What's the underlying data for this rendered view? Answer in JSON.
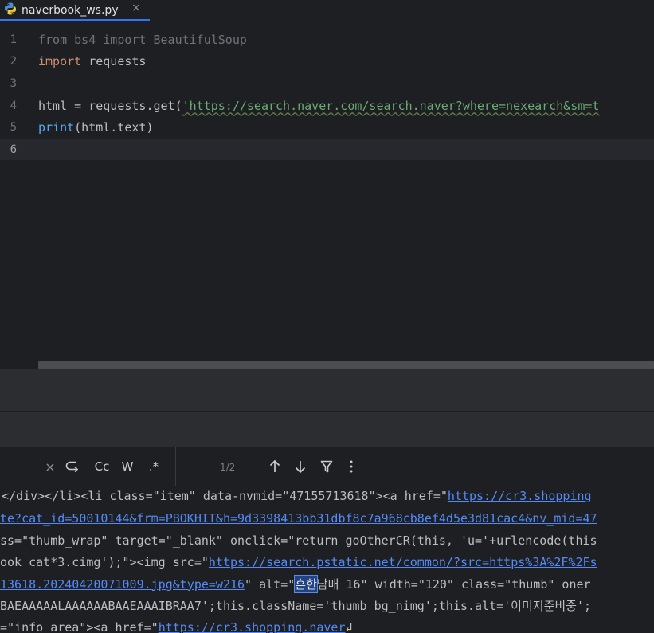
{
  "tab": {
    "filename": "naverbook_ws.py",
    "close_glyph": "×",
    "icon": "python-icon"
  },
  "editor": {
    "lines": [
      {
        "num": "1",
        "tokens": [
          {
            "t": "from bs4 import BeautifulSoup",
            "c": "dim"
          }
        ]
      },
      {
        "num": "2",
        "tokens": [
          {
            "t": "import",
            "c": "kw"
          },
          {
            "t": " requests",
            "c": ""
          }
        ]
      },
      {
        "num": "3",
        "tokens": []
      },
      {
        "num": "4",
        "tokens": [
          {
            "t": "html = requests.get(",
            "c": ""
          },
          {
            "t": "'https://search.naver.com/search.naver?where=nexearch&sm=t",
            "c": "str"
          }
        ]
      },
      {
        "num": "5",
        "tokens": [
          {
            "t": "print",
            "c": "fn"
          },
          {
            "t": "(html.text)",
            "c": ""
          }
        ]
      },
      {
        "num": "6",
        "tokens": []
      }
    ]
  },
  "find": {
    "close_glyph": "×",
    "regex_label": ".*",
    "match_case_label": "Cc",
    "words_label": "W",
    "count": "1/2",
    "icons": [
      "close-icon",
      "replace-icon",
      "match-case-icon",
      "words-icon",
      "regex-icon",
      "prev-icon",
      "next-icon",
      "filter-icon",
      "more-icon"
    ]
  },
  "output": {
    "lines": [
      [
        {
          "t": "</div></li><li class=\"item\" data-nvmid=\"47155713618\"><a href=\"",
          "c": ""
        },
        {
          "t": "https://cr3.shopping",
          "c": "link"
        }
      ],
      [
        {
          "t": "te?cat_id=50010144&frm=PBOKHIT&h=9d3398413bb31dbf8c7a968cb8ef4d5e3d81cac4&nv_mid=47",
          "c": "link"
        }
      ],
      [
        {
          "t": "ss=\"thumb_wrap\" target=\"_blank\" onclick=\"return goOtherCR(this, 'u='+urlencode(this",
          "c": ""
        }
      ],
      [
        {
          "t": "ook_cat*3.cimg');\"><img src=\"",
          "c": ""
        },
        {
          "t": "https://search.pstatic.net/common/?src=https%3A%2F%2Fs",
          "c": "link"
        }
      ],
      [
        {
          "t": "13618.20240420071009.jpg&type=w216",
          "c": "link"
        },
        {
          "t": "\" alt=\"",
          "c": ""
        },
        {
          "t": "흔한",
          "c": "hl"
        },
        {
          "t": "남매 16\" width=\"120\" class=\"thumb\" oner",
          "c": ""
        }
      ],
      [
        {
          "t": "BAEAAAAALAAAAAABAAEAAAIBRAA7';this.className='thumb bg_nimg';this.alt='이미지준비중';",
          "c": ""
        }
      ],
      [
        {
          "t": "=\"info_area\"><a href=\"",
          "c": ""
        },
        {
          "t": "https://cr3.shopping.naver",
          "c": "link"
        },
        {
          "t": "↲",
          "c": ""
        }
      ]
    ]
  }
}
